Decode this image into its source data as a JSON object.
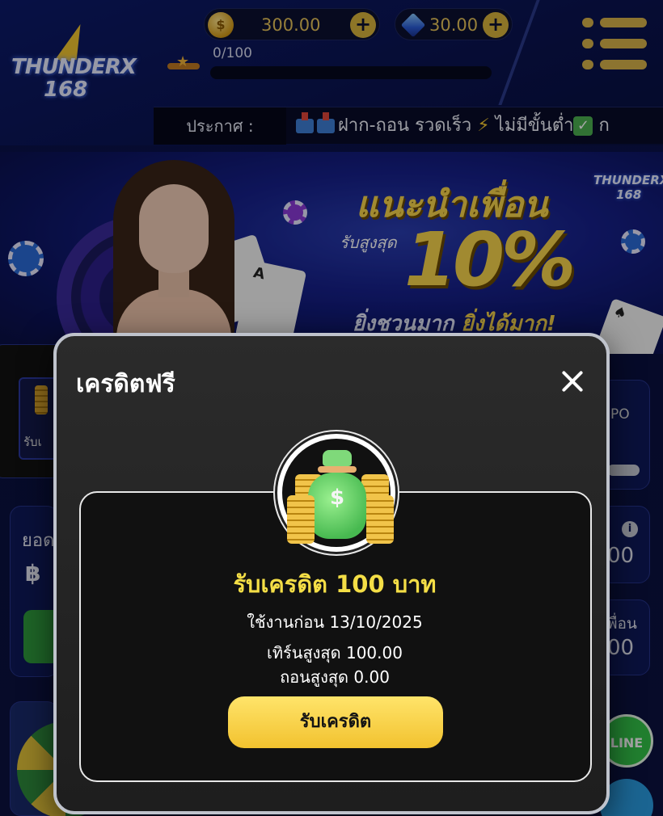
{
  "header": {
    "logo_line1": "THUNDERX",
    "logo_line2": "168",
    "coin_balance": "300.00",
    "gem_balance": "30.00",
    "coin_symbol": "$",
    "xp_progress": "0/100",
    "xp_fraction": 0
  },
  "announcement": {
    "label": "ประกาศ :",
    "text_fast": "ฝาก-ถอน รวดเร็ว",
    "text_nomin": "ไม่มีขั้นต่ำ",
    "text_tail": "ก"
  },
  "banner": {
    "logo_line1": "THUNDERX",
    "logo_line2": "168",
    "headline": "แนะนำเพื่อน",
    "subhead": "รับสูงสุด",
    "percent": "10%",
    "tagline_a": "ยิ่งชวนมาก",
    "tagline_b": "ยิ่งได้มาก!",
    "card_a": "A",
    "card_spade": "♠"
  },
  "background": {
    "left_tile_label": "รับเ",
    "right_tile_label": "PO",
    "balance_label": "ยอด",
    "baht_symbol": "฿",
    "right_value_1": "00",
    "right_label_2": "พื่อน",
    "right_value_2": "00",
    "info_icon": "i",
    "line_label": "LINE"
  },
  "modal": {
    "title": "เครดิตฟรี",
    "reward_title": "รับเครดิต 100 บาท",
    "expiry": "ใช้งานก่อน 13/10/2025",
    "max_turnover": "เทิร์นสูงสุด 100.00",
    "max_withdraw": "ถอนสูงสุด 0.00",
    "claim_button": "รับเครดิต",
    "bag_symbol": "$"
  },
  "colors": {
    "accent_gold": "#f4de46",
    "button_gold": "#f2c22f",
    "background_navy": "#0b1452"
  }
}
